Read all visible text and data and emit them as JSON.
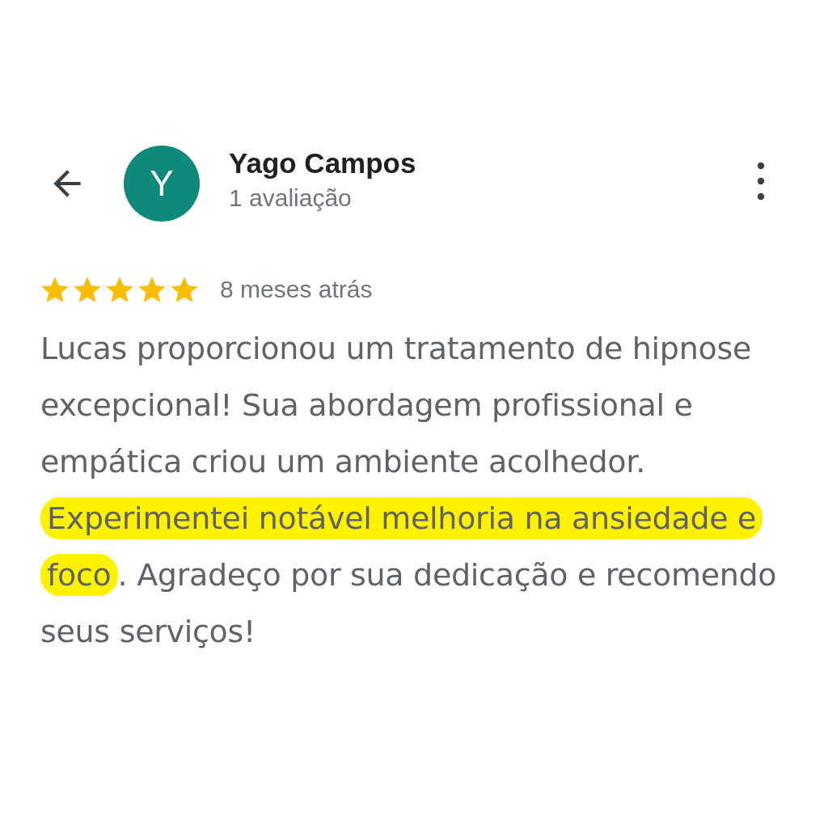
{
  "reviewer": {
    "initial": "Y",
    "name": "Yago Campos",
    "review_count": "1 avaliação",
    "color": "#0f8a7a"
  },
  "review": {
    "stars": 5,
    "time": "8 meses atrás",
    "text": [
      {
        "text": "Lucas proporcionou um tratamento de hipnose excepcional! Sua abordagem profissional e empática criou um ambiente acolhedor. ",
        "highlighted": false
      },
      {
        "text": "Experimentei notável melhoria na ansiedade e foco",
        "highlighted": true
      },
      {
        "text": ". Agradeço por sua dedicação e recomendo seus serviços!",
        "highlighted": false
      }
    ]
  }
}
